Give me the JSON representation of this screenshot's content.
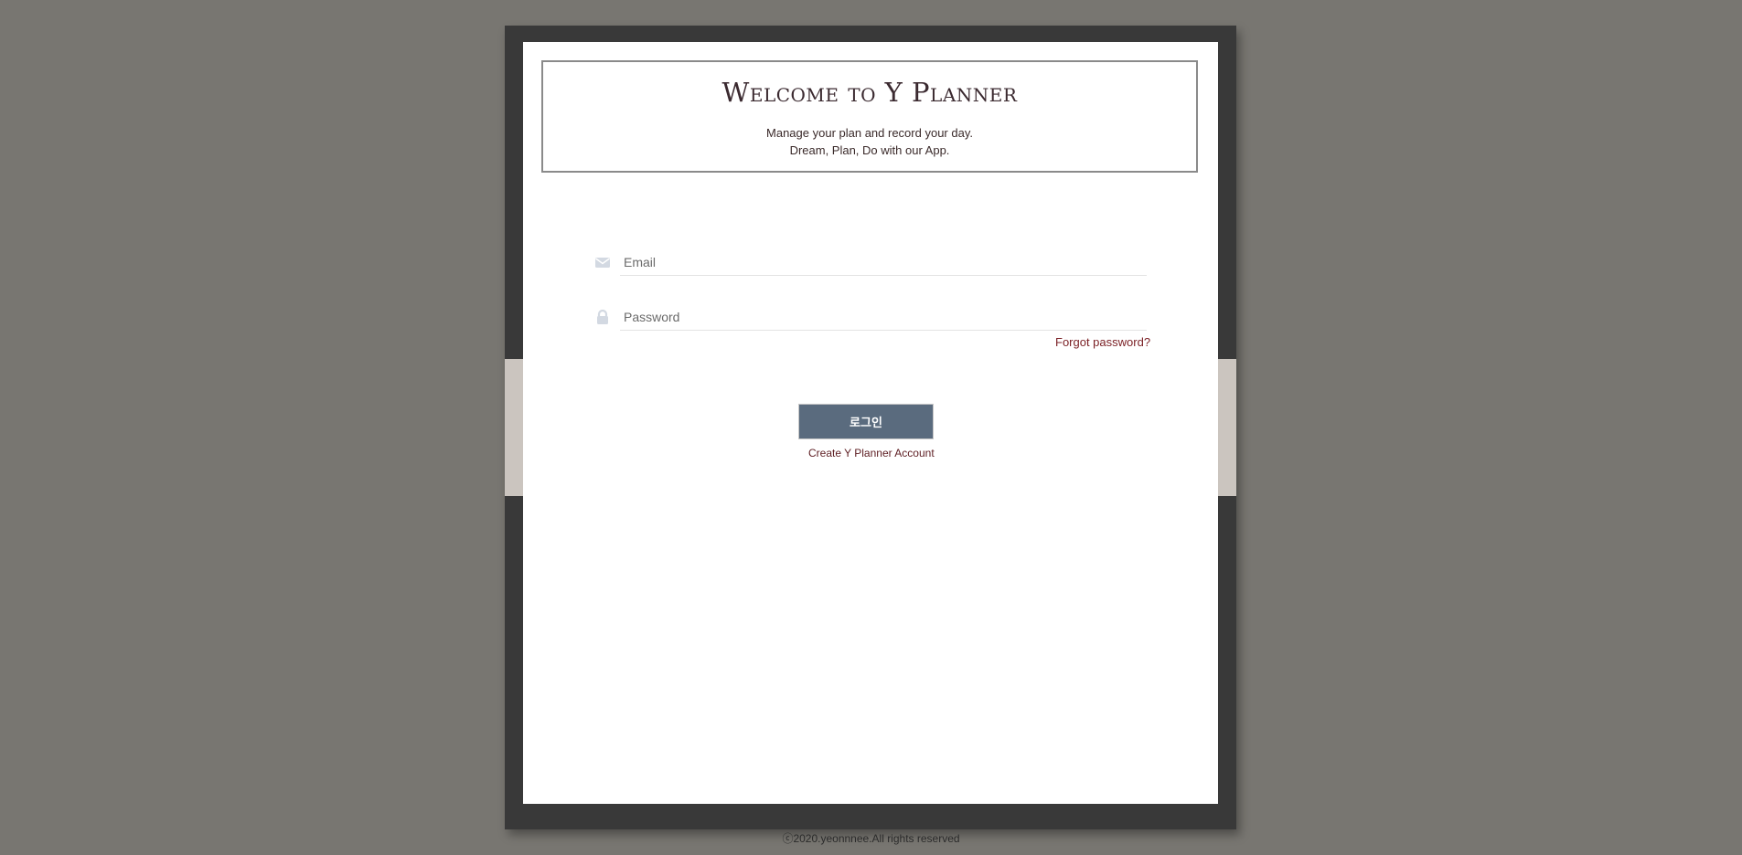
{
  "header": {
    "title": "Welcome to Y Planner",
    "subtitle_line1": "Manage your plan and record your day.",
    "subtitle_line2": "Dream, Plan, Do with our App."
  },
  "form": {
    "email": {
      "placeholder": "Email",
      "value": "",
      "icon": "envelope-icon"
    },
    "password": {
      "placeholder": "Password",
      "value": "",
      "icon": "lock-icon"
    },
    "forgot_label": "Forgot password?",
    "login_label": "로그인",
    "create_account_label": "Create Y Planner Account"
  },
  "footer": {
    "copyright": "ⓒ2020.yeonnnee.All rights reserved"
  },
  "colors": {
    "background": "#787671",
    "frame": "#393939",
    "side_tab": "#cbc5bf",
    "button": "#5a6b7e",
    "link": "#7a1f24"
  }
}
